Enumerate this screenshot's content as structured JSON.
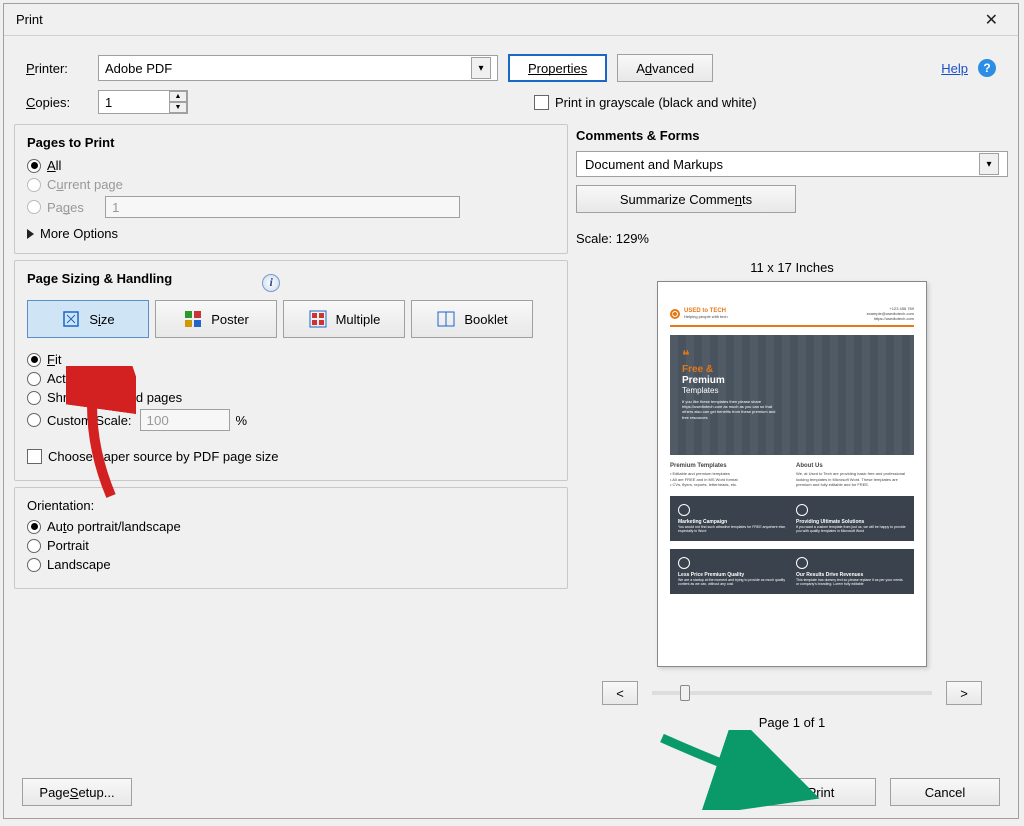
{
  "window": {
    "title": "Print"
  },
  "top": {
    "printer_label": "Printer:",
    "printer_value": "Adobe PDF",
    "properties_btn": "Properties",
    "advanced_btn": "Advanced",
    "help_link": "Help",
    "copies_label": "Copies:",
    "copies_value": "1",
    "grayscale_label": "Print in grayscale (black and white)"
  },
  "pages_to_print": {
    "title": "Pages to Print",
    "all": "All",
    "current": "Current page",
    "pages": "Pages",
    "pages_value": "1",
    "more": "More Options"
  },
  "sizing": {
    "title": "Page Sizing & Handling",
    "size_btn": "Size",
    "poster_btn": "Poster",
    "multiple_btn": "Multiple",
    "booklet_btn": "Booklet",
    "fit": "Fit",
    "actual": "Actual size",
    "shrink": "Shrink oversized pages",
    "custom": "Custom Scale:",
    "custom_value": "100",
    "percent": "%",
    "choose_paper": "Choose paper source by PDF page size"
  },
  "orientation": {
    "title": "Orientation:",
    "auto": "Auto portrait/landscape",
    "portrait": "Portrait",
    "landscape": "Landscape"
  },
  "comments": {
    "title": "Comments & Forms",
    "selected": "Document and Markups",
    "summarize_btn": "Summarize Comments"
  },
  "preview": {
    "scale_label": "Scale: 129%",
    "dimensions": "11 x 17 Inches",
    "page_label": "Page 1 of 1",
    "prev": "<",
    "next": ">",
    "doc": {
      "brand": "USED to TECH",
      "tag": "Helping people with tech",
      "hero1": "Free &",
      "hero2": "Premium",
      "hero3": "Templates",
      "col1_h": "Premium Templates",
      "col2_h": "About Us",
      "d1_h": "Marketing Campaign",
      "d2_h": "Providing Ultimate Solutions",
      "d3_h": "Less Price Premium Quality",
      "d4_h": "Our Results Drive Revenues"
    }
  },
  "footer": {
    "page_setup": "Page Setup...",
    "print": "Print",
    "cancel": "Cancel"
  }
}
